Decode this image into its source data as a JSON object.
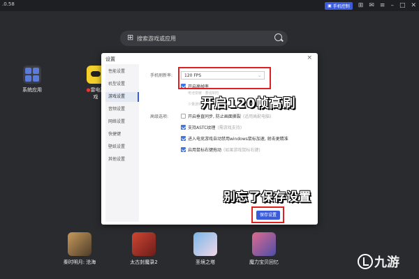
{
  "window": {
    "version": ".0.58",
    "handle_label": "手机控制",
    "controls": [
      "gift-icon",
      "mail-icon",
      "menu-icon",
      "minimize-icon",
      "maximize-icon",
      "close-icon"
    ]
  },
  "search": {
    "placeholder": "搜索游戏或应用"
  },
  "desktop_apps": [
    {
      "label": "系统应用"
    },
    {
      "label": "雷电游戏"
    }
  ],
  "dock_apps": [
    {
      "label": "秦时明月: 沧海"
    },
    {
      "label": "太古封魔录2"
    },
    {
      "label": "圣境之塔"
    },
    {
      "label": "魔力宝贝回忆"
    }
  ],
  "dialog": {
    "title": "设置",
    "close": "×",
    "sidebar": [
      {
        "label": "性能设置",
        "active": false
      },
      {
        "label": "机型设置",
        "active": false
      },
      {
        "label": "游戏设置",
        "active": true
      },
      {
        "label": "音频设置",
        "active": false
      },
      {
        "label": "网络设置",
        "active": false
      },
      {
        "label": "快捷键",
        "active": false
      },
      {
        "label": "壁纸设置",
        "active": false
      },
      {
        "label": "其他设置",
        "active": false
      }
    ],
    "fps_label": "手机刷新率:",
    "fps_value": "120 FPS",
    "high_fps_checkbox": "开启高帧率",
    "hints": [
      "电池变暖 · 要强制性",
      "",
      "少量游戏支持"
    ],
    "advanced_label": "高级选项:",
    "advanced_options": [
      {
        "label": "开启垂直同步, 防止画面撕裂",
        "note": "(适用高配电脑)",
        "checked": false
      },
      {
        "label": "支持ASTC纹理",
        "note": "(需游戏支持)",
        "checked": true
      },
      {
        "label": "进入电竞游戏自动禁用windows鼠标加速, 射击更精准",
        "note": "",
        "checked": true
      },
      {
        "label": "启用鼠标右键拖动",
        "note": "(如果游戏鼠标右键)",
        "checked": true
      }
    ],
    "save_label": "保存设置"
  },
  "annotations": {
    "callout_fps": "开启120帧高刷",
    "callout_save": "别忘了保存设置",
    "highlight_color": "#e02020"
  },
  "watermark": {
    "text": "九游"
  }
}
